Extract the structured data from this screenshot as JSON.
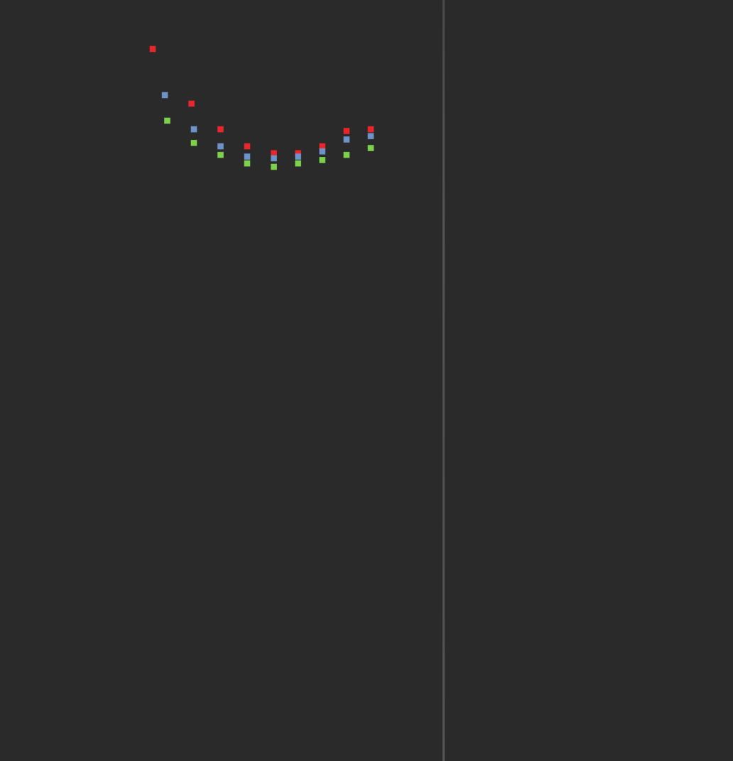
{
  "colors": {
    "background": "#2a2a2a",
    "divider": "#555555"
  },
  "chart_data": {
    "type": "scatter",
    "title": "",
    "xlabel": "",
    "ylabel": "",
    "grid": false,
    "legend": "none",
    "x": [
      1,
      2,
      3,
      4,
      5,
      6,
      7,
      8,
      9,
      10
    ],
    "series": [
      {
        "color": "#e8262b",
        "marker": "square",
        "points": [
          [
            0.6,
            1.0
          ],
          [
            2.2,
            0.68
          ],
          [
            3.4,
            0.53
          ],
          [
            4.5,
            0.43
          ],
          [
            5.6,
            0.39
          ],
          [
            6.6,
            0.39
          ],
          [
            7.6,
            0.43
          ],
          [
            8.6,
            0.52
          ],
          [
            9.6,
            0.53
          ]
        ]
      },
      {
        "color": "#6d93c8",
        "marker": "square",
        "points": [
          [
            1.1,
            0.73
          ],
          [
            2.3,
            0.53
          ],
          [
            3.4,
            0.43
          ],
          [
            4.5,
            0.37
          ],
          [
            5.6,
            0.36
          ],
          [
            6.6,
            0.37
          ],
          [
            7.6,
            0.4
          ],
          [
            8.6,
            0.47
          ],
          [
            9.6,
            0.49
          ]
        ]
      },
      {
        "color": "#7ed14a",
        "marker": "square",
        "points": [
          [
            1.2,
            0.58
          ],
          [
            2.3,
            0.45
          ],
          [
            3.4,
            0.38
          ],
          [
            4.5,
            0.33
          ],
          [
            5.6,
            0.31
          ],
          [
            6.6,
            0.33
          ],
          [
            7.6,
            0.35
          ],
          [
            8.6,
            0.38
          ],
          [
            9.6,
            0.42
          ]
        ]
      }
    ]
  }
}
